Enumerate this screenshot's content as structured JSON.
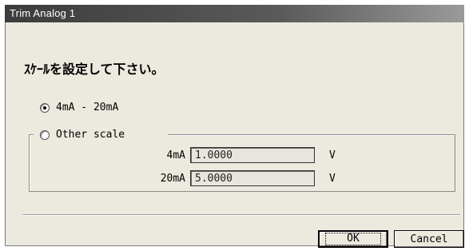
{
  "window": {
    "title": "Trim Analog 1"
  },
  "prompt": "ｽｹｰﾙを設定して下さい。",
  "options": {
    "preset_label": "4mA - 20mA",
    "other_label": "Other scale",
    "selected": "preset"
  },
  "scale": {
    "low_label": "4mA",
    "low_value": "1.0000",
    "low_unit": "V",
    "high_label": "20mA",
    "high_value": "5.0000",
    "high_unit": "V"
  },
  "buttons": {
    "ok_label": "OK",
    "cancel_label": "Cancel"
  }
}
